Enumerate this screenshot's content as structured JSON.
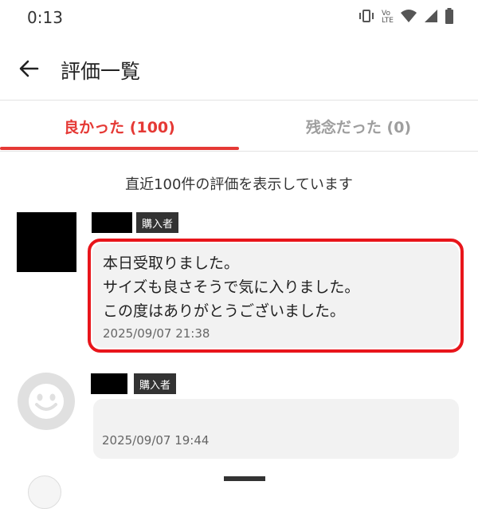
{
  "status_bar": {
    "time": "0:13",
    "icons": [
      "vibrate-icon",
      "volte-icon",
      "wifi-icon",
      "signal-icon",
      "battery-icon"
    ],
    "volte_label_top": "Vo",
    "volte_label_bottom": "LTE"
  },
  "app_bar": {
    "back_icon": "arrow-left-icon",
    "title": "評価一覧"
  },
  "tabs": [
    {
      "label": "良かった (100)",
      "active": true
    },
    {
      "label": "残念だった (0)",
      "active": false
    }
  ],
  "colors": {
    "accent": "#e53935",
    "highlight": "#e8151b",
    "bubble": "#f2f2f2"
  },
  "notice": "直近100件の評価を表示しています",
  "reviews": [
    {
      "badge": "購入者",
      "lines": [
        "本日受取りました。",
        "サイズも良さそうで気に入りました。",
        "この度はありがとうございました。"
      ],
      "date": "2025/09/07 21:38",
      "highlighted": true
    },
    {
      "badge": "購入者",
      "lines": [],
      "date": "2025/09/07 19:44",
      "highlighted": false
    }
  ]
}
